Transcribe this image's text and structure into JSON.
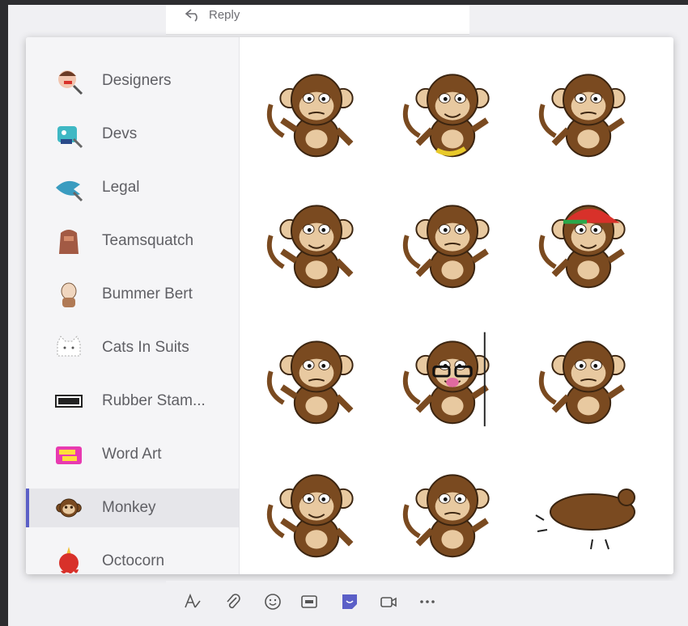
{
  "message": {
    "reply_label": "Reply"
  },
  "sticker_picker": {
    "categories": [
      {
        "label": "Designers",
        "icon": "designers-icon"
      },
      {
        "label": "Devs",
        "icon": "devs-icon"
      },
      {
        "label": "Legal",
        "icon": "legal-icon"
      },
      {
        "label": "Teamsquatch",
        "icon": "teamsquatch-icon"
      },
      {
        "label": "Bummer Bert",
        "icon": "bummer-bert-icon"
      },
      {
        "label": "Cats In Suits",
        "icon": "cats-in-suits-icon"
      },
      {
        "label": "Rubber Stam...",
        "icon": "rubber-stamp-icon"
      },
      {
        "label": "Word Art",
        "icon": "word-art-icon"
      },
      {
        "label": "Monkey",
        "icon": "monkey-icon",
        "selected": true
      },
      {
        "label": "Octocorn",
        "icon": "octocorn-icon"
      }
    ],
    "stickers": [
      {
        "name": "monkey-angry-sticker"
      },
      {
        "name": "monkey-banana-sticker"
      },
      {
        "name": "monkey-shocked-sticker"
      },
      {
        "name": "monkey-sleepy-sticker"
      },
      {
        "name": "monkey-arms-up-sticker"
      },
      {
        "name": "monkey-cap-sticker"
      },
      {
        "name": "monkey-laughing-sticker"
      },
      {
        "name": "monkey-disguise-sticker"
      },
      {
        "name": "monkey-side-eye-sticker"
      },
      {
        "name": "monkey-worried-sticker"
      },
      {
        "name": "monkey-wink-sticker"
      },
      {
        "name": "monkey-lying-down-sticker"
      }
    ]
  },
  "toolbar": {
    "items": [
      "format-icon",
      "attach-icon",
      "emoji-icon",
      "gif-icon",
      "sticker-icon",
      "meet-now-icon",
      "more-options-icon"
    ]
  },
  "colors": {
    "accent": "#5b5fc7",
    "monkey_brown": "#7a4a20",
    "monkey_face": "#e8c9a0"
  }
}
